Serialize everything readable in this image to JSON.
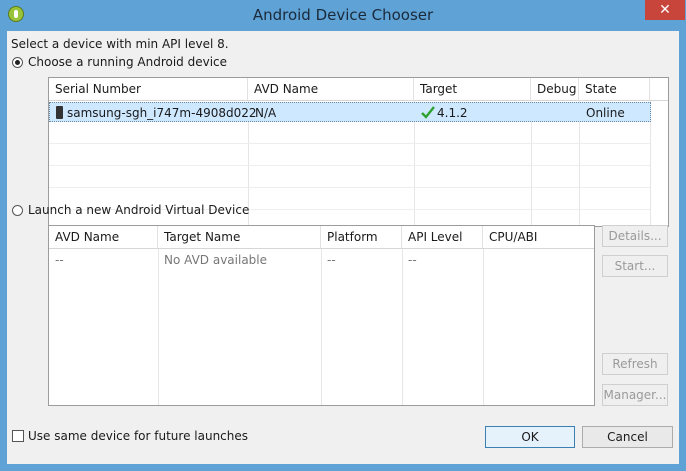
{
  "window": {
    "title": "Android Device Chooser",
    "close_glyph": "✕"
  },
  "intro": "Select a device with min API level 8.",
  "running": {
    "radio_label": "Choose a running Android device",
    "columns": [
      "Serial Number",
      "AVD Name",
      "Target",
      "Debug",
      "State"
    ],
    "rows": [
      {
        "serial": "samsung-sgh_i747m-4908d022",
        "avd": "N/A",
        "target": "4.1.2",
        "debug": "",
        "state": "Online"
      }
    ]
  },
  "virtual": {
    "radio_label": "Launch a new Android Virtual Device",
    "columns": [
      "AVD Name",
      "Target Name",
      "Platform",
      "API Level",
      "CPU/ABI"
    ],
    "rows": [
      {
        "avd": "--",
        "target": "No AVD available",
        "platform": "--",
        "api": "--",
        "cpu": ""
      }
    ],
    "buttons": {
      "details": "Details...",
      "start": "Start...",
      "refresh": "Refresh",
      "manager": "Manager..."
    }
  },
  "footer": {
    "checkbox_label": "Use same device for future launches",
    "ok": "OK",
    "cancel": "Cancel"
  },
  "colors": {
    "title_bar": "#5ea2d6",
    "close": "#c7453b",
    "selection": "#cde8ff",
    "check": "#2ea12e"
  }
}
